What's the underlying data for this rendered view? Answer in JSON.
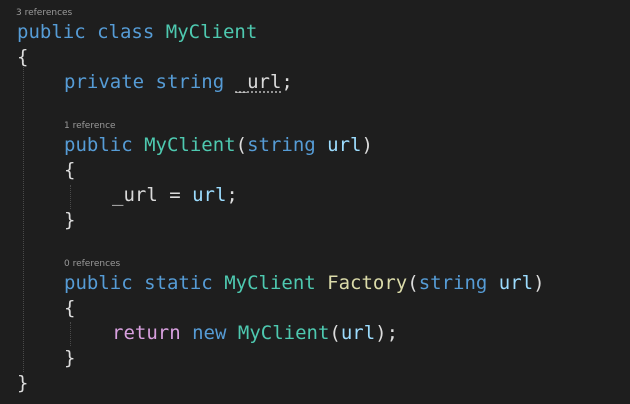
{
  "theme": {
    "background": "#1e1e1e",
    "keyword": "#569cd6",
    "type": "#4ec9b0",
    "method": "#dcdcaa",
    "control_keyword": "#d8a0df",
    "parameter": "#9cdcfe",
    "text": "#dcdcdc",
    "codelens": "#9a9a9a"
  },
  "codelens": {
    "class_refs": "3 references",
    "ctor_refs": "1 reference",
    "factory_refs": "0 references"
  },
  "code": {
    "class_decl": {
      "kw1": "public",
      "kw2": "class",
      "name": "MyClient"
    },
    "open_brace_class": "{",
    "field_decl": {
      "kw1": "private",
      "kw2": "string",
      "name": "_url",
      "semi": ";"
    },
    "ctor_decl": {
      "kw1": "public",
      "name": "MyClient",
      "open_paren": "(",
      "param_type": "string",
      "param_name": "url",
      "close_paren": ")"
    },
    "open_brace_ctor": "{",
    "ctor_body": {
      "lhs": "_url",
      "op": " = ",
      "rhs": "url",
      "semi": ";"
    },
    "close_brace_ctor": "}",
    "factory_decl": {
      "kw1": "public",
      "kw2": "static",
      "return_type": "MyClient",
      "name": "Factory",
      "open_paren": "(",
      "param_type": "string",
      "param_name": "url",
      "close_paren": ")"
    },
    "open_brace_factory": "{",
    "factory_body": {
      "kw_return": "return",
      "kw_new": "new",
      "type": "MyClient",
      "open_paren": "(",
      "arg": "url",
      "close_paren": ")",
      "semi": ";"
    },
    "close_brace_factory": "}",
    "close_brace_class": "}"
  }
}
